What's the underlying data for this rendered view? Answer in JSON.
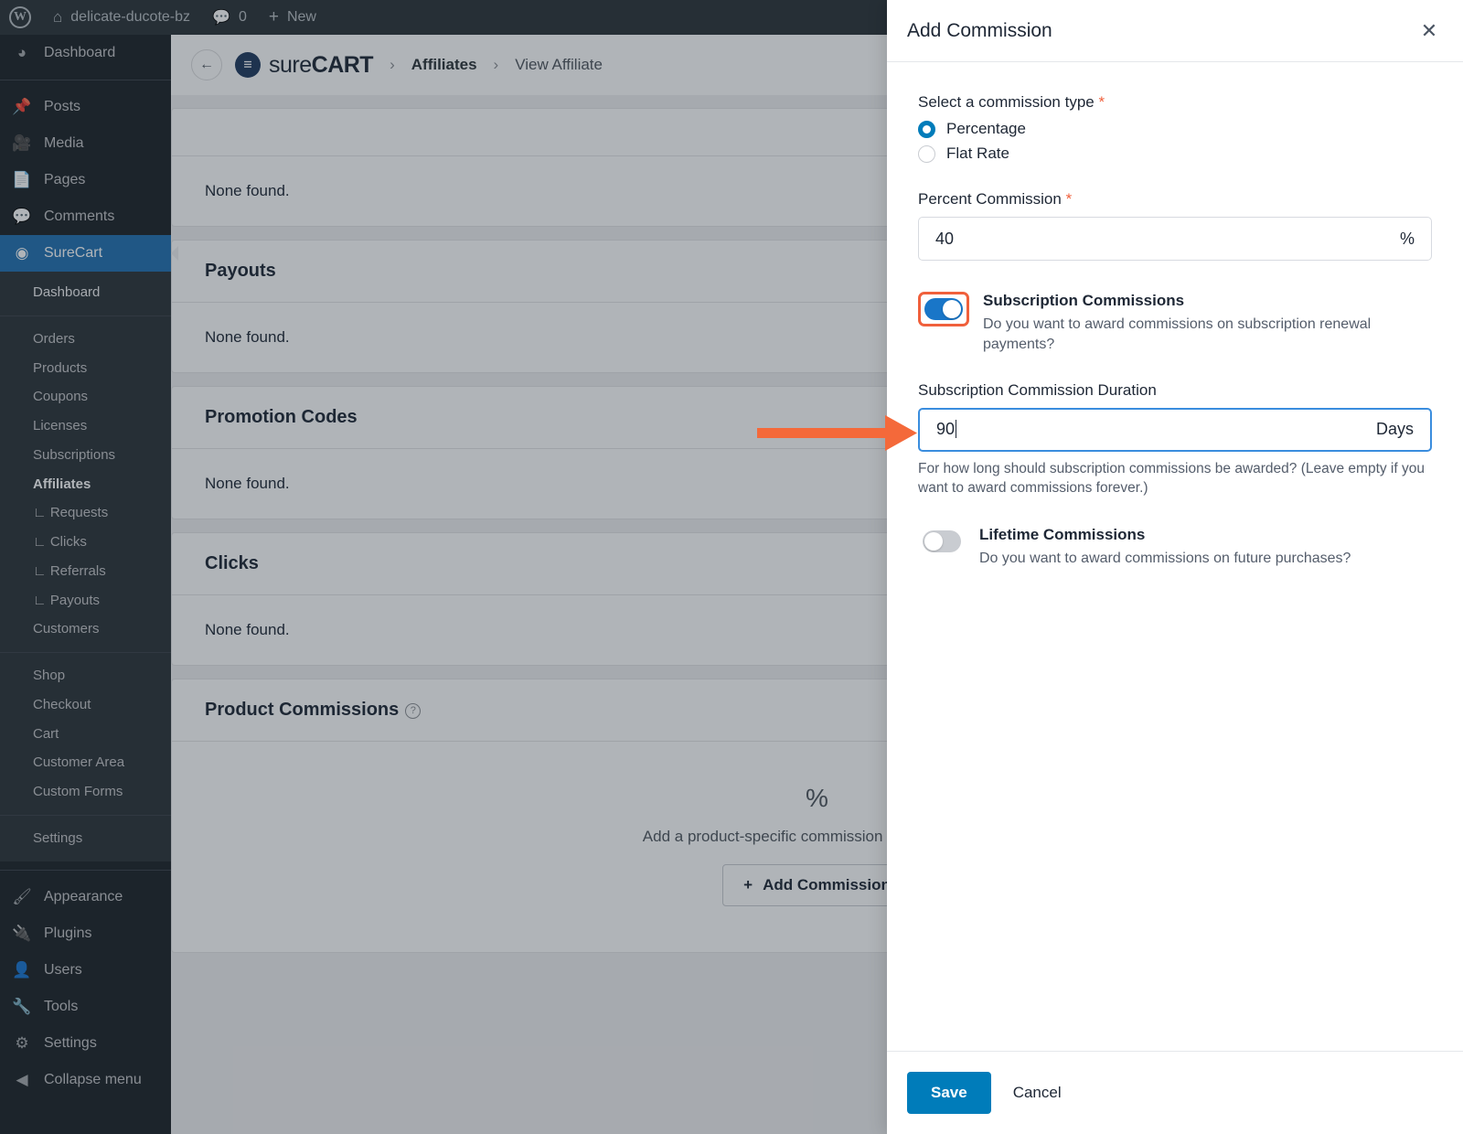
{
  "adminbar": {
    "wp_logo_icon": "wordpress-icon",
    "home_icon": "home-icon",
    "site_name": "delicate-ducote-bz",
    "comments_icon": "comment-bubble-icon",
    "comments_count": "0",
    "new_icon": "plus-icon",
    "new_label": "New"
  },
  "adminmenu": {
    "top_items": [
      {
        "label": "Dashboard",
        "icon": "dashboard-gauge-icon"
      },
      {
        "label": "Posts",
        "icon": "pin-icon"
      },
      {
        "label": "Media",
        "icon": "media-icon"
      },
      {
        "label": "Pages",
        "icon": "pages-icon"
      },
      {
        "label": "Comments",
        "icon": "comment-bubble-icon"
      },
      {
        "label": "SureCart",
        "icon": "surecart-icon",
        "current": true
      }
    ],
    "surecart_submenu": [
      {
        "label": "Dashboard",
        "type": "header"
      },
      {
        "label": "Orders"
      },
      {
        "label": "Products"
      },
      {
        "label": "Coupons"
      },
      {
        "label": "Licenses"
      },
      {
        "label": "Subscriptions"
      },
      {
        "label": "Affiliates",
        "current": true
      },
      {
        "label": "∟ Requests",
        "nested": true
      },
      {
        "label": "∟ Clicks",
        "nested": true
      },
      {
        "label": "∟ Referrals",
        "nested": true
      },
      {
        "label": "∟ Payouts",
        "nested": true
      },
      {
        "label": "Customers"
      },
      {
        "label": "Shop",
        "group": 2
      },
      {
        "label": "Checkout",
        "group": 2
      },
      {
        "label": "Cart",
        "group": 2
      },
      {
        "label": "Customer Area",
        "group": 2
      },
      {
        "label": "Custom Forms",
        "group": 2
      },
      {
        "label": "Settings",
        "group": 3,
        "type": "header"
      }
    ],
    "bottom_items": [
      {
        "label": "Appearance",
        "icon": "paintbrush-icon"
      },
      {
        "label": "Plugins",
        "icon": "plug-icon"
      },
      {
        "label": "Users",
        "icon": "user-icon"
      },
      {
        "label": "Tools",
        "icon": "wrench-icon"
      },
      {
        "label": "Settings",
        "icon": "sliders-icon"
      },
      {
        "label": "Collapse menu",
        "icon": "collapse-arrow-icon"
      }
    ]
  },
  "topbar": {
    "back_icon": "arrow-left-icon",
    "brand_logo_icon": "surecart-logo-icon",
    "brand_sure": "sure",
    "brand_cart": "CART",
    "separator": "›",
    "crumb_affiliates": "Affiliates",
    "crumb_view_affiliate": "View Affiliate"
  },
  "main": {
    "sections": [
      {
        "id": "referrals-empty",
        "title": null,
        "empty": "None found."
      },
      {
        "id": "payouts",
        "title": "Payouts",
        "empty": "None found."
      },
      {
        "id": "promotion-codes",
        "title": "Promotion Codes",
        "empty": "None found."
      },
      {
        "id": "clicks",
        "title": "Clicks",
        "empty": "None found."
      }
    ],
    "product_commissions": {
      "title": "Product Commissions",
      "help_icon": "question-mark-icon",
      "empty_icon": "percent-icon",
      "empty_icon_glyph": "%",
      "empty_text": "Add a product-specific commission for this affiliate.",
      "add_button_icon": "plus-icon",
      "add_button_label": "Add Commission"
    }
  },
  "panel": {
    "title": "Add Commission",
    "close_icon": "close-x-icon",
    "commission_type": {
      "label": "Select a commission type",
      "required_marker": "*",
      "options": [
        {
          "label": "Percentage",
          "selected": true
        },
        {
          "label": "Flat Rate",
          "selected": false
        }
      ]
    },
    "percent_commission": {
      "label": "Percent Commission",
      "required_marker": "*",
      "value": "40",
      "suffix": "%"
    },
    "subscription_commissions": {
      "title": "Subscription Commissions",
      "description": "Do you want to award commissions on subscription renewal payments?",
      "enabled": true
    },
    "subscription_duration": {
      "label": "Subscription Commission Duration",
      "value": "90",
      "suffix": "Days",
      "focused": true,
      "help": "For how long should subscription commissions be awarded? (Leave empty if you want to award commissions forever.)"
    },
    "lifetime_commissions": {
      "title": "Lifetime Commissions",
      "description": "Do you want to award commissions on future purchases?",
      "enabled": false
    },
    "footer": {
      "save_label": "Save",
      "cancel_label": "Cancel"
    }
  },
  "annotations": {
    "arrow_color": "#F4693A",
    "highlight_color": "#F0603C",
    "arrow_target": "subscription-commission-duration-input",
    "highlight_target": "subscription-commissions-toggle"
  },
  "colors": {
    "accent_blue": "#007cba",
    "toggle_on": "#1976c8",
    "admin_dark": "#1d2327",
    "admin_submenu": "#2c3338",
    "current_menu": "#2271b1",
    "required_orange": "#f0603c"
  }
}
